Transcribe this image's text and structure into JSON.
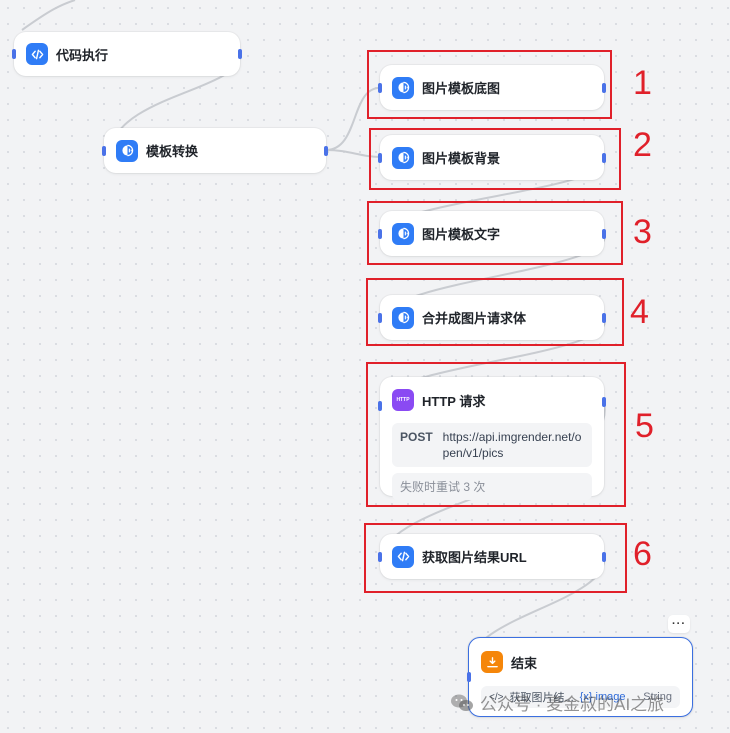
{
  "nodes": {
    "code_exec": {
      "title": "代码执行",
      "icon": "code-icon"
    },
    "template_convert": {
      "title": "模板转换",
      "icon": "template-icon"
    },
    "img_base": {
      "title": "图片模板底图",
      "icon": "template-icon"
    },
    "img_bg": {
      "title": "图片模板背景",
      "icon": "template-icon"
    },
    "img_text": {
      "title": "图片模板文字",
      "icon": "template-icon"
    },
    "merge_body": {
      "title": "合并成图片请求体",
      "icon": "template-icon"
    },
    "http": {
      "title": "HTTP 请求",
      "icon_text": "HTTP",
      "method": "POST",
      "url": "https://api.imgrender.net/open/v1/pics",
      "retry": "失败时重试 3 次"
    },
    "get_url": {
      "title": "获取图片结果URL",
      "icon": "code-icon"
    },
    "end": {
      "title": "结束",
      "more": "···",
      "output_source": "获取图片结...",
      "output_var": "{x} image",
      "output_type": "String"
    }
  },
  "annotations": [
    "1",
    "2",
    "3",
    "4",
    "5",
    "6"
  ],
  "watermark": "公众号 · 麦金叔的AI之旅",
  "colors": {
    "accent_blue": "#2f7cf6",
    "http_purple": "#8a4af3",
    "end_orange": "#f5860a",
    "annotation_red": "#e0202a",
    "selected_border": "#3b6fe0"
  }
}
